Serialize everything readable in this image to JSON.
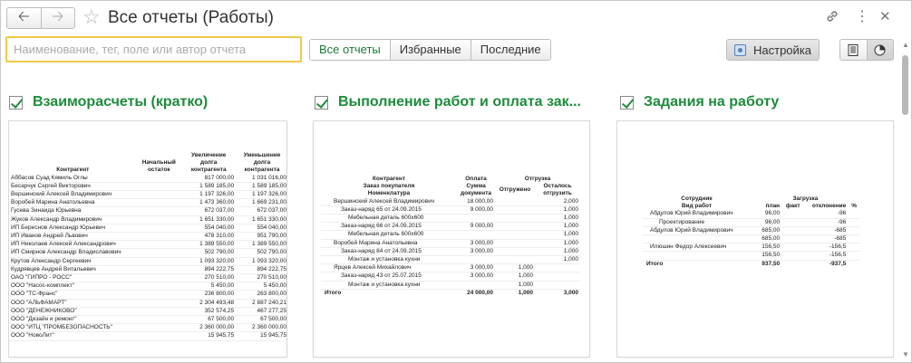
{
  "window": {
    "title": "Все отчеты (Работы)",
    "icons": {
      "back": "arrow-left-icon",
      "forward": "arrow-right-icon",
      "favorite": "star-icon",
      "link": "link-icon",
      "more": "more-icon",
      "close": "close-icon"
    }
  },
  "toolbar": {
    "search_placeholder": "Наименование, тег, поле или автор отчета",
    "tabs": [
      "Все отчеты",
      "Избранные",
      "Последние"
    ],
    "setup_label": "Настройка"
  },
  "reports": [
    {
      "title": "Взаиморасчеты (кратко)",
      "headers": [
        "Контрагент",
        "Начальный остаток",
        "Увеличение долга контрагента",
        "Уменьшение долга контрагента"
      ],
      "rows": [
        [
          "Аббасов Суад Кямиль Оглы",
          "",
          "817 000,00",
          "1 031 016,00"
        ],
        [
          "Бесарчук Сергей Викторович",
          "",
          "1 589 185,00",
          "1 589 185,00"
        ],
        [
          "Вершинский Алексей Владимирович",
          "",
          "1 197 326,00",
          "1 197 326,00"
        ],
        [
          "Воробей Марина Анатольевна",
          "",
          "1 473 360,00",
          "1 669 231,00"
        ],
        [
          "Гусева Зинаида Юрьевна",
          "",
          "672 037,00",
          "672 037,00"
        ],
        [
          "Жуков Александр Владимирович",
          "",
          "1 651 330,00",
          "1 651 330,00"
        ],
        [
          "ИП Береснов Александр Юрьевич",
          "",
          "554 040,00",
          "554 040,00"
        ],
        [
          "ИП Иванов Андрей Львович",
          "",
          "478 310,00",
          "951 790,00"
        ],
        [
          "ИП Николаев Алексей Александрович",
          "",
          "1 389 550,00",
          "1 389 550,00"
        ],
        [
          "ИП Смирнов Александр Владиславович",
          "",
          "502 790,00",
          "502 790,00"
        ],
        [
          "Крутов Александр Сергеевич",
          "",
          "1 093 320,00",
          "1 093 320,00"
        ],
        [
          "Кудрявцев Андрей Витальевич",
          "",
          "894 222,75",
          "894 222,75"
        ],
        [
          "ОАО \"ГИПРО - РОСС\"",
          "",
          "270 510,00",
          "270 510,00"
        ],
        [
          "ООО \"Насос-комплект\"",
          "",
          "5 450,00",
          "5 450,00"
        ],
        [
          "ООО \"ТС-Франс\"",
          "",
          "236 800,00",
          "263 800,00"
        ],
        [
          "ООО \"АЛЬФАМАРТ\"",
          "",
          "2 304 493,48",
          "2 887 240,21"
        ],
        [
          "ООО \"ДЕНЕЖНИКОВО\"",
          "",
          "352 574,25",
          "467 277,25"
        ],
        [
          "ООО \"Дизайн и ремонт\"",
          "",
          "67 500,00",
          "67 500,00"
        ],
        [
          "ООО \"ИТЦ \"ПРОМБЕЗОПАСНОСТЬ\"",
          "",
          "2 360 000,00",
          "2 360 000,00"
        ],
        [
          "ООО \"НовоЛит\"",
          "",
          "15 945,75",
          "15 945,75"
        ]
      ]
    },
    {
      "title": "Выполнение работ и оплата зак...",
      "headers": {
        "h1": [
          "Контрагент",
          "Оплата",
          "Отгрузка"
        ],
        "h2": [
          "Заказ покупателя",
          "Сумма",
          "Отгружено",
          "Осталось"
        ],
        "h3": [
          "Номенклатура",
          "документа",
          "",
          "отгрузить"
        ]
      },
      "rows": [
        {
          "label": "Вершинский Алексей Владимирович",
          "sum": "18 000,00",
          "shipped": "",
          "left": "2,000"
        },
        {
          "label": "Заказ-наряд 65 от 24.09.2015",
          "sum": "9 000,00",
          "shipped": "",
          "left": "1,000"
        },
        {
          "label": "Мебельная деталь 600х600",
          "sum": "",
          "shipped": "",
          "left": "1,000"
        },
        {
          "label": "Заказ-наряд 66 от 24.09.2015",
          "sum": "9 000,00",
          "shipped": "",
          "left": "1,000"
        },
        {
          "label": "Мебельная деталь 600х600",
          "sum": "",
          "shipped": "",
          "left": "1,000"
        },
        {
          "label": "Воробей Марина Анатольевна",
          "sum": "3 000,00",
          "shipped": "",
          "left": "1,000"
        },
        {
          "label": "Заказ-наряд 84 от 24.09.2015",
          "sum": "3 000,00",
          "shipped": "",
          "left": "1,000"
        },
        {
          "label": "Монтаж и установка кухни",
          "sum": "",
          "shipped": "",
          "left": "1,000"
        },
        {
          "label": "Ярцев Алексей Михайлович",
          "sum": "3 000,00",
          "shipped": "1,000",
          "left": ""
        },
        {
          "label": "Заказ-наряд 43 от 25.07.2015",
          "sum": "3 000,00",
          "shipped": "1,000",
          "left": ""
        },
        {
          "label": "Монтаж и установка кухни",
          "sum": "",
          "shipped": "1,000",
          "left": ""
        }
      ],
      "total": {
        "label": "Итого",
        "sum": "24 000,00",
        "shipped": "1,000",
        "left": "3,000"
      }
    },
    {
      "title": "Задания на работу",
      "headers": {
        "h1": [
          "Сотрудник",
          "Загрузка"
        ],
        "h2": [
          "Вид работ",
          "план",
          "факт",
          "отклонение",
          "%"
        ]
      },
      "rows": [
        {
          "label": "Абдулов Юрий Владимирович",
          "plan": "96,00",
          "fact": "",
          "dev": "-96"
        },
        {
          "label": "Проектирование",
          "plan": "96,00",
          "fact": "",
          "dev": "-96"
        },
        {
          "label": "Абдулов Юрий Владимирович",
          "plan": "685,00",
          "fact": "",
          "dev": "-685"
        },
        {
          "label": "",
          "plan": "685,00",
          "fact": "",
          "dev": "-685"
        },
        {
          "label": "Илюшин Федор Алексеевич",
          "plan": "156,50",
          "fact": "",
          "dev": "-156,5"
        },
        {
          "label": "",
          "plan": "156,50",
          "fact": "",
          "dev": "-156,5"
        }
      ],
      "total": {
        "label": "Итого",
        "plan": "937,50",
        "fact": "",
        "dev": "-937,5"
      }
    }
  ]
}
